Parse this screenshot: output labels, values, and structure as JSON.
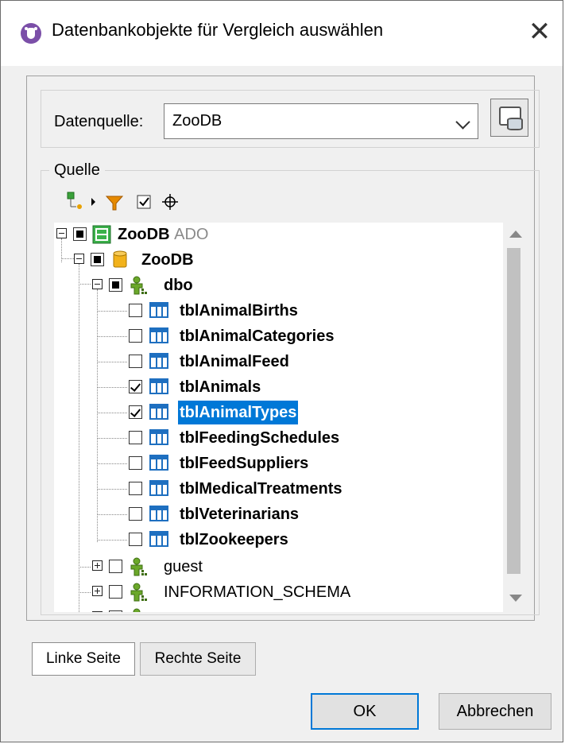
{
  "window": {
    "title": "Datenbankobjekte für Vergleich auswählen",
    "close_glyph": "✕"
  },
  "datasource": {
    "label": "Datenquelle:",
    "selected": "ZooDB"
  },
  "source_group": {
    "label": "Quelle"
  },
  "tree": {
    "root": {
      "name": "ZooDB",
      "suffix": "ADO"
    },
    "database": {
      "name": "ZooDB"
    },
    "schema": {
      "name": "dbo"
    },
    "tables": [
      {
        "name": "tblAnimalBirths",
        "checked": false
      },
      {
        "name": "tblAnimalCategories",
        "checked": false
      },
      {
        "name": "tblAnimalFeed",
        "checked": false
      },
      {
        "name": "tblAnimals",
        "checked": true
      },
      {
        "name": "tblAnimalTypes",
        "checked": true,
        "selected": true
      },
      {
        "name": "tblFeedingSchedules",
        "checked": false
      },
      {
        "name": "tblFeedSuppliers",
        "checked": false
      },
      {
        "name": "tblMedicalTreatments",
        "checked": false
      },
      {
        "name": "tblVeterinarians",
        "checked": false
      },
      {
        "name": "tblZookeepers",
        "checked": false
      }
    ],
    "other_schemas": [
      {
        "name": "guest"
      },
      {
        "name": "INFORMATION_SCHEMA"
      }
    ]
  },
  "tabs": [
    {
      "label": "Linke Seite",
      "active": true
    },
    {
      "label": "Rechte Seite",
      "active": false
    }
  ],
  "buttons": {
    "ok": "OK",
    "cancel": "Abbrechen"
  },
  "colors": {
    "selection": "#0078d7",
    "table_icon": "#1e6fc0",
    "schema_icon": "#4e8a16",
    "db_icon": "#f2b21b",
    "server_icon": "#2f9e3a"
  }
}
